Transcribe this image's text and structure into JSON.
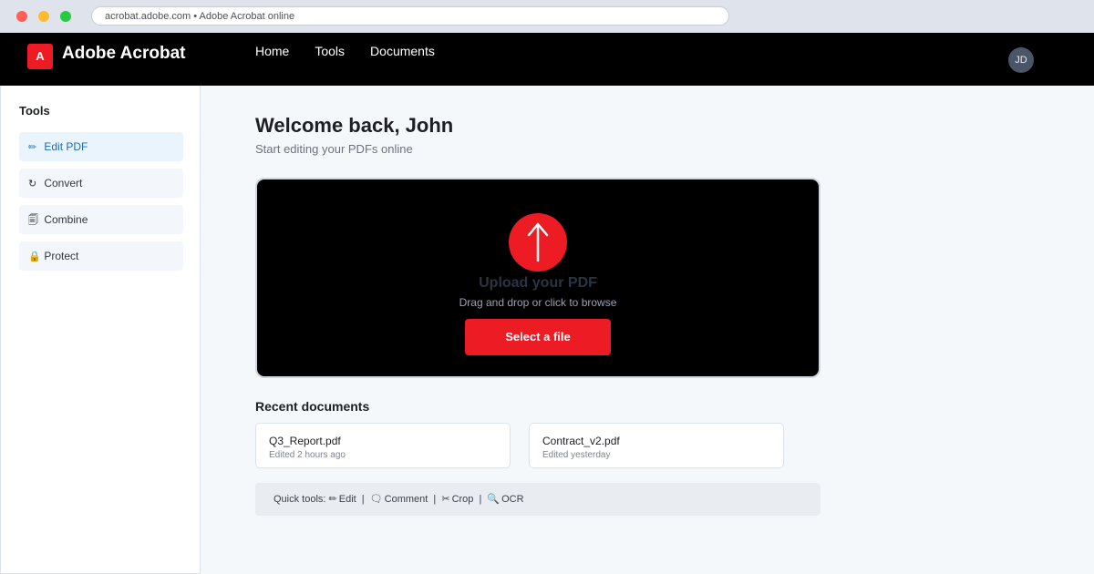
{
  "browser": {
    "url_text": "acrobat.adobe.com • Adobe Acrobat online"
  },
  "header": {
    "logo_letter": "A",
    "brand": "Adobe Acrobat",
    "nav": [
      {
        "label": "Home"
      },
      {
        "label": "Tools"
      },
      {
        "label": "Documents"
      }
    ],
    "avatar_initials": "JD"
  },
  "sidebar": {
    "title": "Tools",
    "items": [
      {
        "icon": "✏",
        "label": "Edit PDF",
        "active": true
      },
      {
        "icon": "↻",
        "label": "Convert"
      },
      {
        "icon": "🗐",
        "label": "Combine"
      },
      {
        "icon": "🔒",
        "label": "Protect"
      }
    ]
  },
  "main": {
    "welcome": "Welcome back, John",
    "subtitle": "Start editing your PDFs online",
    "upload": {
      "title": "Upload your PDF",
      "subtitle": "Drag and drop or click to browse",
      "button": "Select a file"
    },
    "recent_title": "Recent documents",
    "recent": [
      {
        "name": "Q3_Report.pdf",
        "meta": "Edited 2 hours ago"
      },
      {
        "name": "Contract_v2.pdf",
        "meta": "Edited yesterday"
      }
    ],
    "quick_tools": {
      "prefix": "Quick tools:",
      "items": [
        {
          "icon": "✏",
          "label": "Edit"
        },
        {
          "icon": "🗨",
          "label": "Comment"
        },
        {
          "icon": "✂",
          "label": "Crop"
        },
        {
          "icon": "🔍",
          "label": "OCR"
        }
      ],
      "separator": "|"
    }
  },
  "colors": {
    "brand_red": "#ed1c24",
    "topbar_bg": "#000000",
    "active_blue": "#1a6fb3"
  }
}
